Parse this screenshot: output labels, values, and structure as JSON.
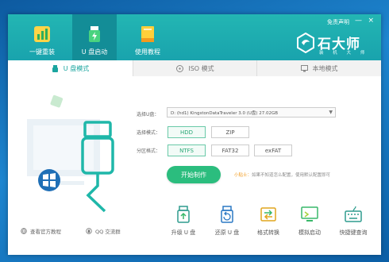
{
  "header": {
    "nav": [
      {
        "label": "一键重装"
      },
      {
        "label": "U 盘启动"
      },
      {
        "label": "使用教程"
      }
    ],
    "disclaimer": "免责声明",
    "min_glyph": "—",
    "close_glyph": "×",
    "brand": {
      "name": "石大师",
      "tagline": "装 机 大 师"
    }
  },
  "tabs": [
    {
      "label": "U 盘模式"
    },
    {
      "label": "ISO 模式"
    },
    {
      "label": "本地模式"
    }
  ],
  "form": {
    "disk_label": "选择U盘：",
    "disk_value": "D:  (hd1) KingstonDataTraveler 3.0 (U盘) 27.02GB",
    "mode_label": "选择模式：",
    "modes": [
      "HDD",
      "ZIP"
    ],
    "partition_label": "分区格式：",
    "partitions": [
      "NTFS",
      "FAT32",
      "exFAT"
    ],
    "start_label": "开始制作",
    "tip_prefix": "小贴士：",
    "tip_text": "如果不知道怎么配置，使用默认配置即可"
  },
  "tools": [
    {
      "label": "升级 U 盘"
    },
    {
      "label": "还原 U 盘"
    },
    {
      "label": "格式转换"
    },
    {
      "label": "模拟启动"
    },
    {
      "label": "快捷键查询"
    }
  ],
  "footer": {
    "website": "查看官方教程",
    "qq": "QQ 交流群"
  },
  "colors": {
    "header": "#1fb0b0",
    "accent_green": "#2bbd7e",
    "selected_border": "#69c9a8"
  }
}
